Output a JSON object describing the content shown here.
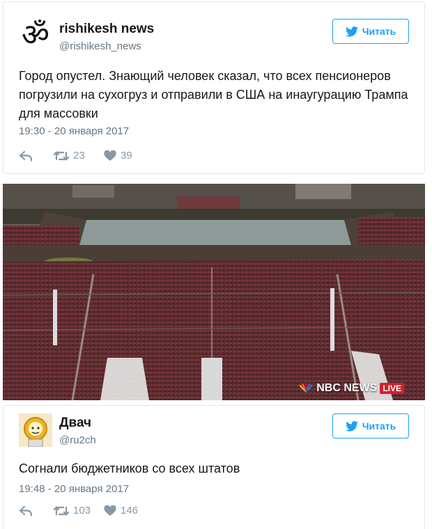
{
  "tweets": [
    {
      "author": "rishikesh news",
      "handle": "@rishikesh_news",
      "avatar_icon": "om-symbol-icon",
      "follow_label": "Читать",
      "text": "Город опустел. Знающий человек сказал, что всех пенсионеров погрузили на сухогруз и отправили в США на инаугурацию Трампа для массовки",
      "time": "19:30 - 20 января 2017",
      "retweets": "23",
      "likes": "39"
    },
    {
      "author": "Двач",
      "handle": "@ru2ch",
      "avatar_icon": "astronaut-avatar-icon",
      "follow_label": "Читать",
      "text": "Согнали бюджетников со всех штатов",
      "time": "19:48 - 20 января 2017",
      "retweets": "103",
      "likes": "146"
    }
  ],
  "photo": {
    "watermark": "NBC NEWS",
    "live_badge": "LIVE"
  },
  "colors": {
    "accent": "#1da1f2",
    "text": "#14171a",
    "muted": "#657786",
    "icon": "#8899a6"
  }
}
